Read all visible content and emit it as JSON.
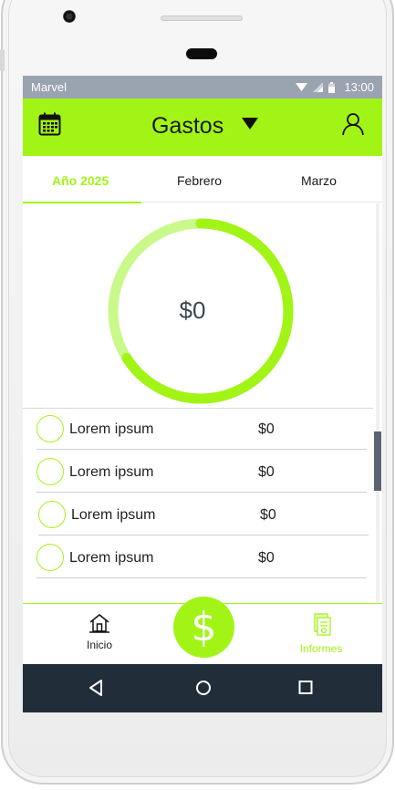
{
  "status_bar": {
    "carrier": "Marvel",
    "time": "13:00",
    "icons": [
      "wifi-icon",
      "signal-icon",
      "battery-icon"
    ]
  },
  "app_bar": {
    "title": "Gastos",
    "left_icon": "calendar-icon",
    "dropdown_icon": "caret-down-icon",
    "right_icon": "user-icon"
  },
  "tabs": [
    {
      "label": "Año 2025",
      "active": true
    },
    {
      "label": "Febrero",
      "active": false
    },
    {
      "label": "Marzo",
      "active": false
    }
  ],
  "summary": {
    "total": "$0"
  },
  "items": [
    {
      "label": "Lorem ipsum",
      "amount": "$0"
    },
    {
      "label": "Lorem ipsum",
      "amount": "$0"
    },
    {
      "label": "Lorem ipsum",
      "amount": "$0"
    },
    {
      "label": "Lorem ipsum",
      "amount": "$0"
    }
  ],
  "bottom_nav": {
    "home_label": "Inicio",
    "fab_symbol": "$",
    "reports_label": "Informes"
  },
  "system_nav": [
    "back-icon",
    "home-icon",
    "recents-icon"
  ],
  "colors": {
    "accent": "#a2f417",
    "accent_light": "#c8f98a",
    "status_bar": "#9aa3b0",
    "system_nav": "#222d3a",
    "text_dark": "#3d4654"
  }
}
